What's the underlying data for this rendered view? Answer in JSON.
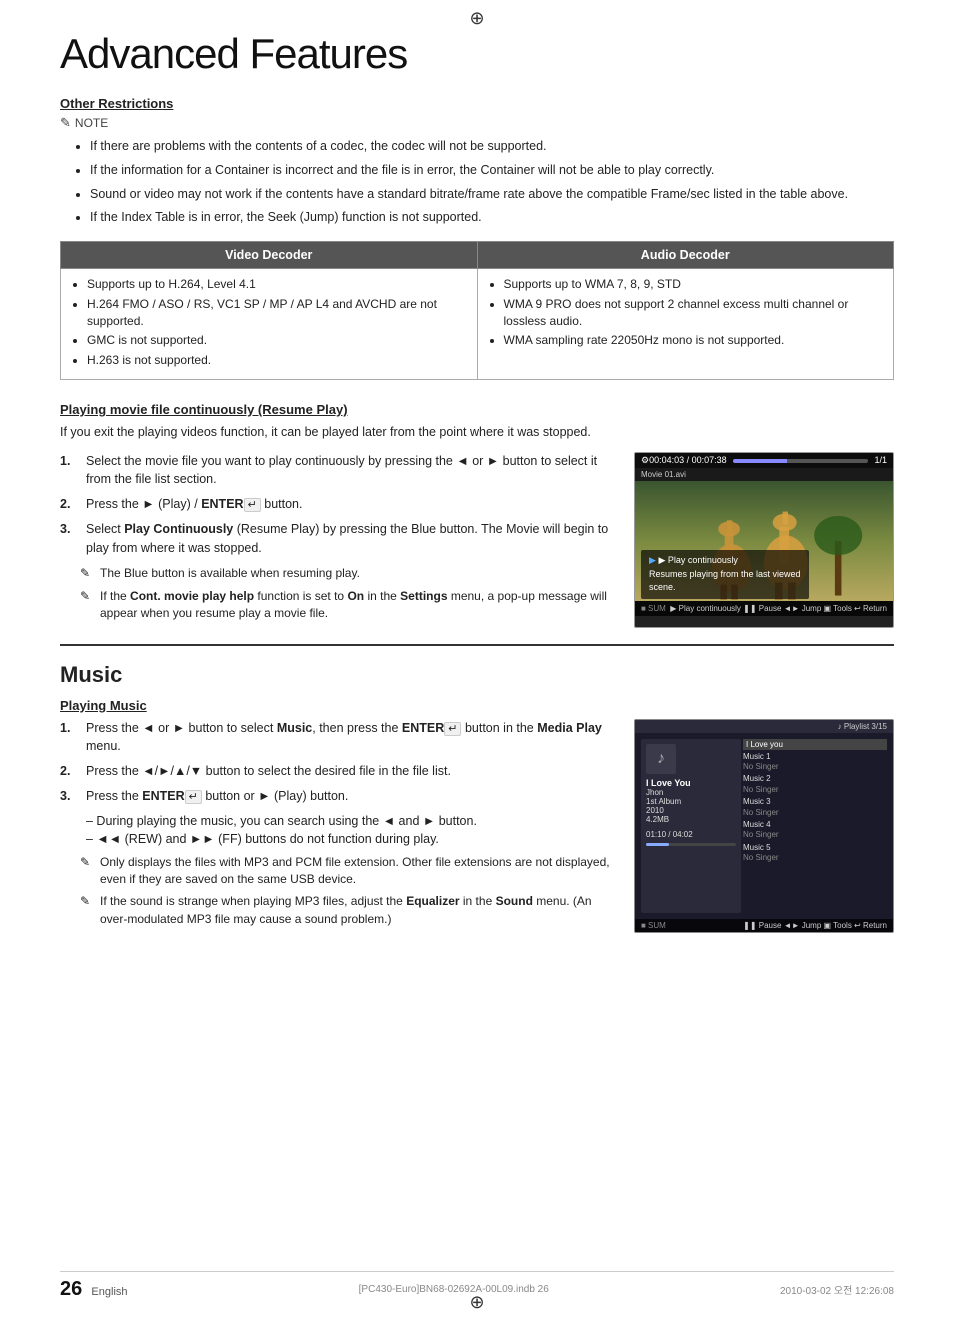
{
  "page": {
    "title": "Advanced Features",
    "crosshair_top": "⊕",
    "crosshair_bot": "⊕"
  },
  "other_restrictions": {
    "heading": "Other Restrictions",
    "note_label": "NOTE",
    "notes": [
      "If there are problems with the contents of a codec, the codec will not be supported.",
      "If the information for a Container is incorrect and the file is in error, the Container will not be able to play correctly.",
      "Sound or video may not work if the contents have a standard bitrate/frame rate above the compatible Frame/sec listed in the table above.",
      "If the Index Table is in error, the Seek (Jump) function is not supported."
    ]
  },
  "codec_table": {
    "col1_header": "Video Decoder",
    "col2_header": "Audio Decoder",
    "col1_items": [
      "Supports up to H.264, Level 4.1",
      "H.264 FMO / ASO / RS, VC1 SP / MP / AP L4 and AVCHD are not supported.",
      "GMC is not supported.",
      "H.263 is not supported."
    ],
    "col2_items": [
      "Supports up to WMA 7, 8, 9, STD",
      "WMA 9 PRO does not support 2 channel excess multi channel or lossless audio.",
      "WMA sampling rate 22050Hz mono is not supported."
    ]
  },
  "resume_play": {
    "heading": "Playing movie file continuously (Resume Play)",
    "description": "If you exit the playing videos function, it can be played later from the point where it was stopped.",
    "steps": [
      {
        "num": "1.",
        "text": "Select the movie file you want to play continuously by pressing the ◄ or ► button to select it from the file list section."
      },
      {
        "num": "2.",
        "text": "Press the ► (Play) / ENTER  button."
      },
      {
        "num": "3.",
        "text": "Select Play Continuously (Resume Play) by pressing the Blue button. The Movie will begin to play from where it was stopped."
      }
    ],
    "notes": [
      "The Blue button is available when resuming play.",
      "If the Cont. movie play help function is set to On in the Settings menu, a pop-up message will appear when you resume play a movie file."
    ],
    "screen": {
      "topbar_left": "00:04:03 / 00:07:38",
      "topbar_right": "1/1",
      "filename": "Movie 01.avi",
      "overlay_line1": "▶ Play continuously",
      "overlay_line2": "Resumes playing from the last viewed",
      "overlay_line3": "scene.",
      "bottombar": "▶ Play continuously  ❚❚ Pause  ◄► Jump  ▣ Tools  ↩ Return"
    }
  },
  "music": {
    "section_title": "Music",
    "playing_heading": "Playing Music",
    "steps": [
      {
        "num": "1.",
        "text": "Press the ◄ or ► button to select Music, then press the ENTER  button in the Media Play menu."
      },
      {
        "num": "2.",
        "text": "Press the ◄/►/▲/▼ button to select the desired file in the file list."
      },
      {
        "num": "3.",
        "text": "Press the ENTER  button or ► (Play) button."
      }
    ],
    "sub_notes": [
      "– During playing the music, you can search using the ◄ and ► button.",
      "– ◄◄ (REW) and ►► (FF) buttons do not function during play."
    ],
    "notes": [
      "Only displays the files with MP3 and PCM file extension. Other file extensions are not displayed, even if they are saved on the same USB device.",
      "If the sound is strange when playing MP3 files, adjust the Equalizer in the Sound menu. (An over-modulated MP3 file may cause a sound problem.)"
    ],
    "screen": {
      "playlist_header": "♪ Playlist    3/15",
      "song_title": "I Love You",
      "artist": "Jhon",
      "album": "1st Album",
      "year": "2010",
      "size": "4.2MB",
      "time": "01:10 / 04:02",
      "selected_title": "I Love you",
      "songs": [
        {
          "title": "Music 1",
          "artist": "No Singer"
        },
        {
          "title": "Music 2",
          "artist": "No Singer"
        },
        {
          "title": "Music 3",
          "artist": "No Singer"
        },
        {
          "title": "Music 4",
          "artist": "No Singer"
        },
        {
          "title": "Music 5",
          "artist": "No Singer"
        }
      ],
      "bottombar": "❚❚ Pause  ◄► Jump  ▣ Tools  ↩ Return"
    }
  },
  "footer": {
    "page_number": "26",
    "language": "English",
    "file_left": "[PC430-Euro]BN68-02692A-00L09.indb   26",
    "file_right": "2010-03-02   오전 12:26:08"
  }
}
